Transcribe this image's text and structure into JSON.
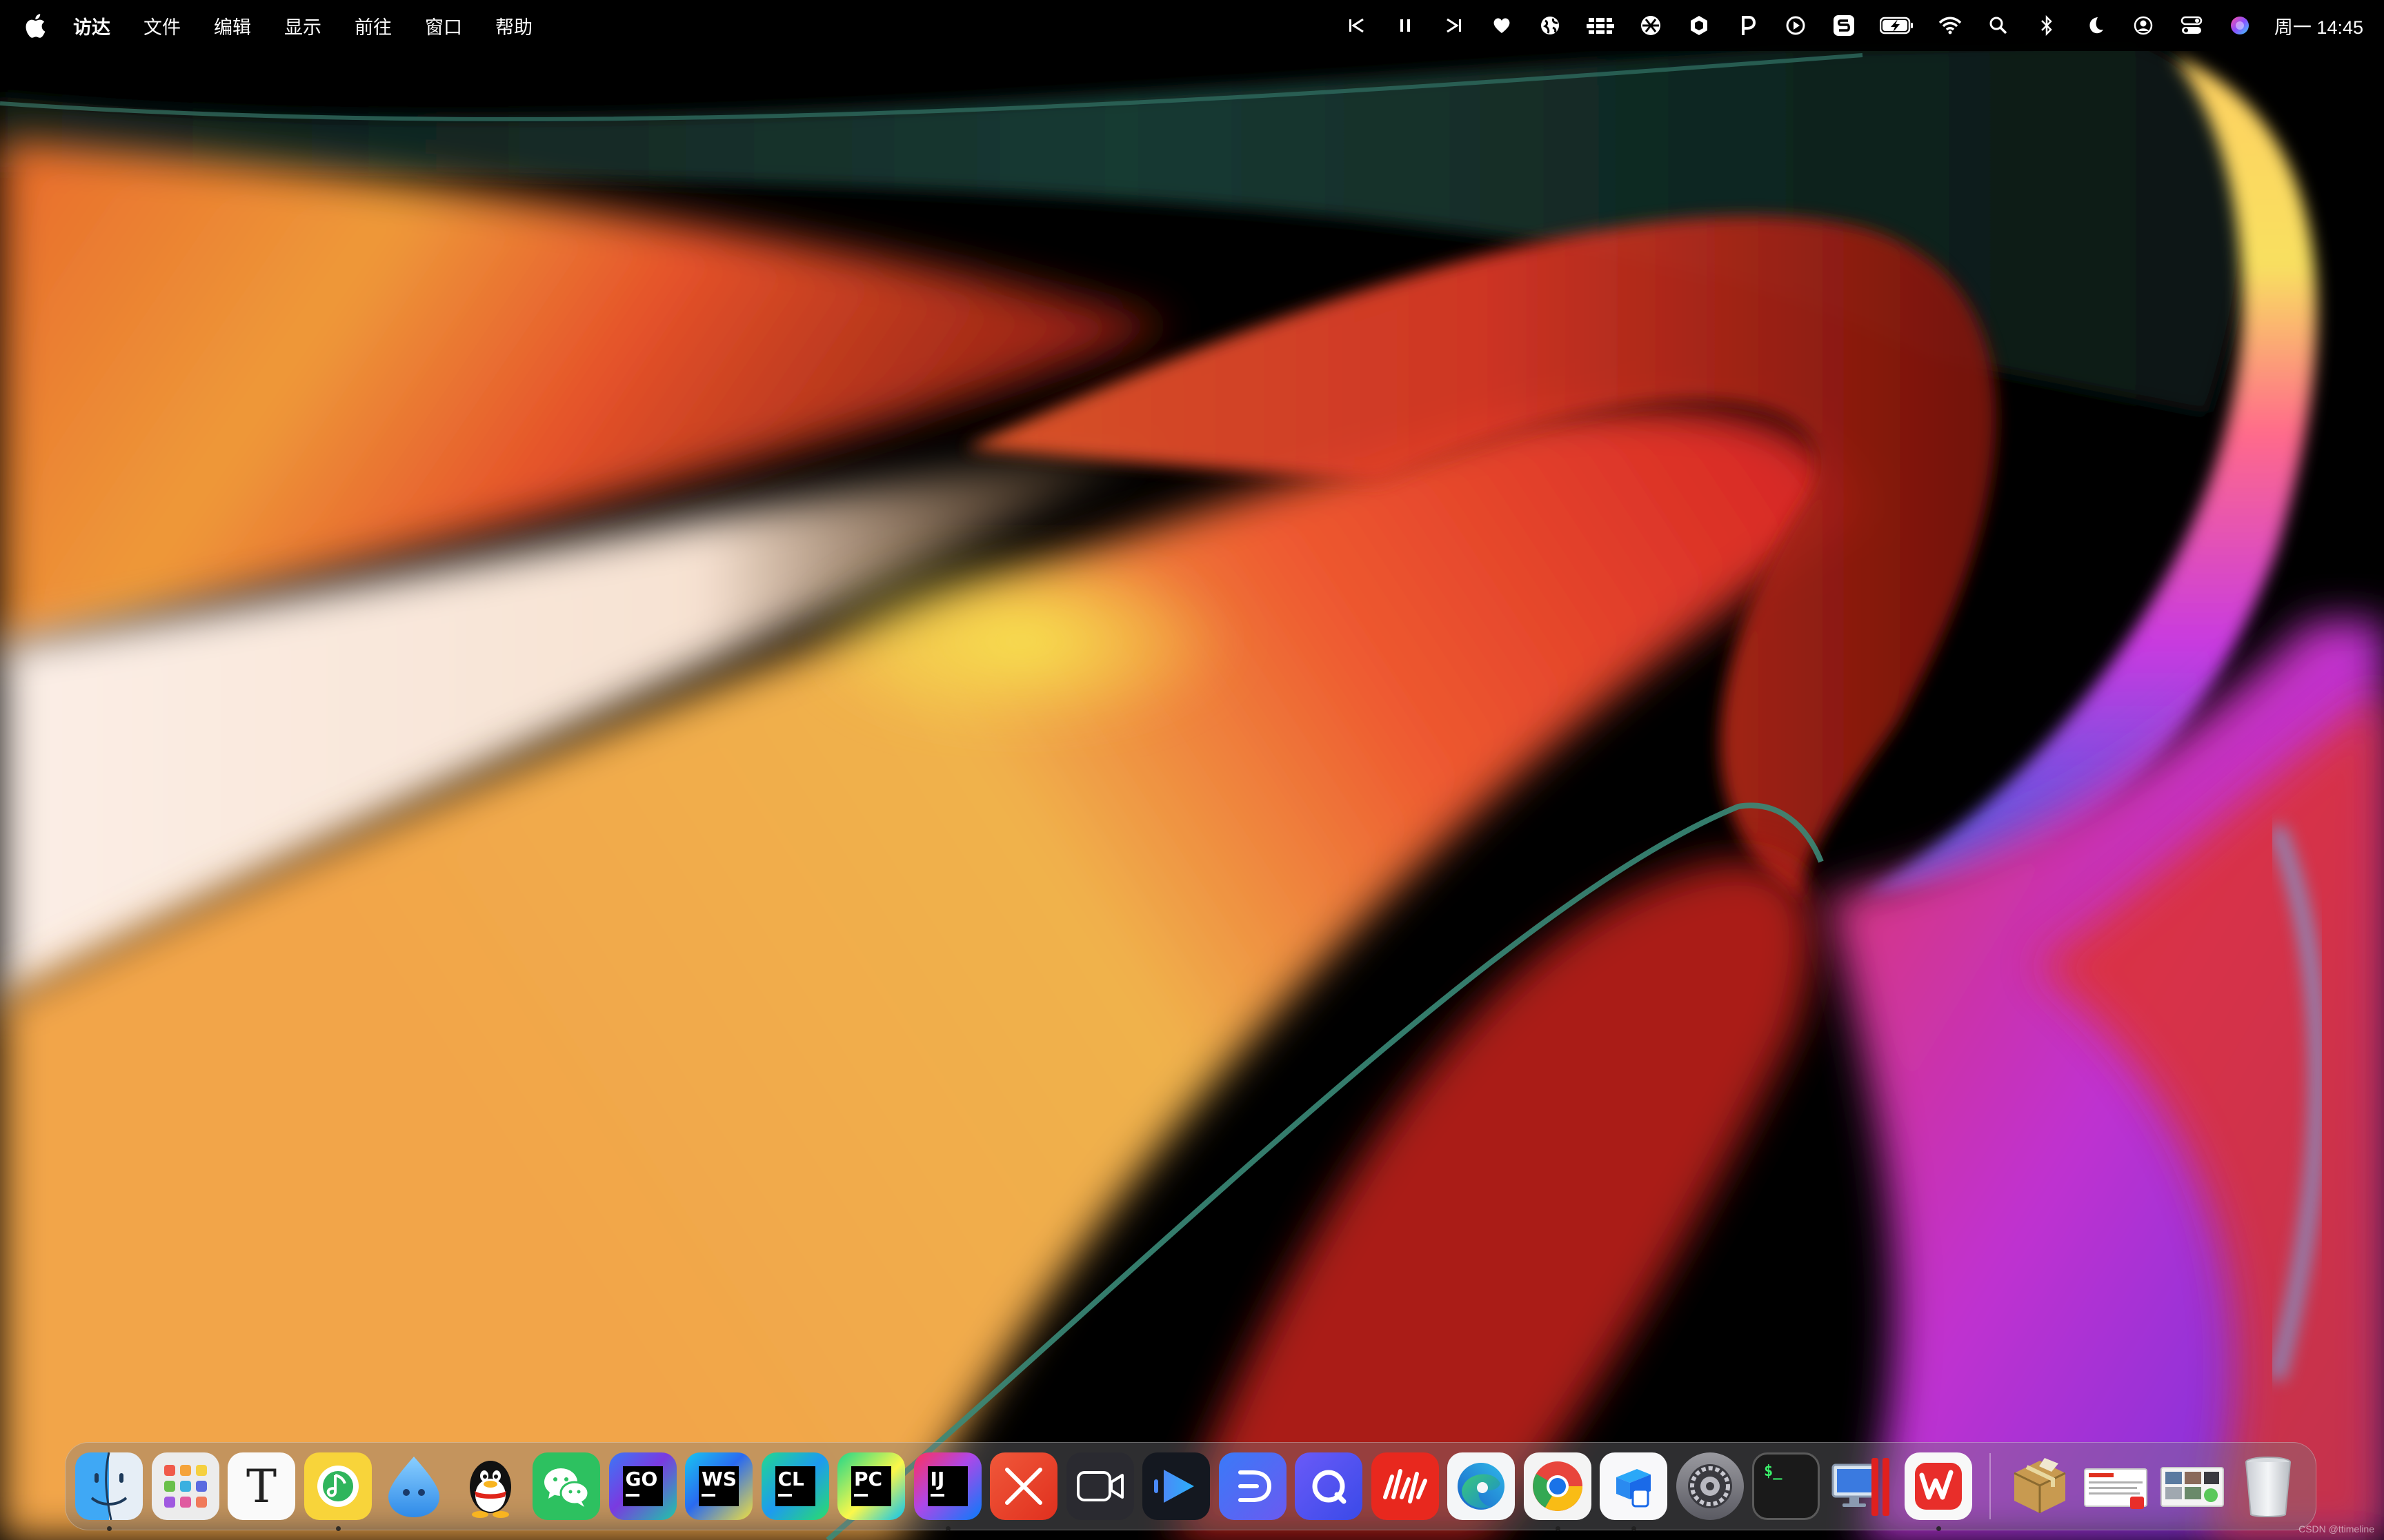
{
  "menubar": {
    "app_name": "访达",
    "menus": [
      "文件",
      "编辑",
      "显示",
      "前往",
      "窗口",
      "帮助"
    ],
    "clock": "周一 14:45",
    "tray_icons": [
      "previous-track-icon",
      "pause-icon",
      "next-track-icon",
      "heart-icon",
      "globe-icon",
      "bartender-icon",
      "aperture-icon",
      "shield-hex-icon",
      "p-app-icon",
      "play-circle-icon",
      "s-app-icon",
      "battery-charging-icon",
      "wifi-icon",
      "spotlight-search-icon",
      "bluetooth-icon",
      "focus-moon-icon",
      "user-account-icon",
      "control-center-icon",
      "siri-icon"
    ]
  },
  "dock": {
    "apps": [
      {
        "name": "finder-icon",
        "running": true
      },
      {
        "name": "launchpad-icon",
        "running": false
      },
      {
        "name": "typora-icon",
        "label": "T",
        "running": false
      },
      {
        "name": "qq-music-icon",
        "running": true
      },
      {
        "name": "water-drop-app-icon",
        "running": false
      },
      {
        "name": "qq-penguin-icon",
        "running": false
      },
      {
        "name": "wechat-icon",
        "running": false
      },
      {
        "name": "goland-icon",
        "label": "GO",
        "running": false
      },
      {
        "name": "webstorm-icon",
        "label": "WS",
        "running": false
      },
      {
        "name": "clion-icon",
        "label": "CL",
        "running": false
      },
      {
        "name": "pycharm-icon",
        "label": "PC",
        "running": false
      },
      {
        "name": "intellij-idea-icon",
        "label": "IJ",
        "running": true
      },
      {
        "name": "xmind-icon",
        "running": false
      },
      {
        "name": "video-camera-icon",
        "running": false
      },
      {
        "name": "infuse-play-icon",
        "running": false
      },
      {
        "name": "lark-d-icon",
        "running": false
      },
      {
        "name": "loop-app-icon",
        "running": false
      },
      {
        "name": "netease-music-wave-icon",
        "running": false
      },
      {
        "name": "edge-browser-icon",
        "running": false
      },
      {
        "name": "chrome-browser-icon",
        "running": true
      },
      {
        "name": "tencent-meeting-icon",
        "running": true
      },
      {
        "name": "system-settings-icon",
        "running": false
      },
      {
        "name": "terminal-icon",
        "label": "$_",
        "running": false
      },
      {
        "name": "parallels-desktop-icon",
        "running": false
      },
      {
        "name": "wps-office-icon",
        "running": true
      }
    ],
    "stacks": [
      {
        "name": "installer-package-icon"
      },
      {
        "name": "document-thumbnail-icon"
      },
      {
        "name": "screenshot-thumbnail-icon"
      },
      {
        "name": "trash-icon"
      }
    ]
  },
  "watermark": "CSDN @ttimeline",
  "colors": {
    "menubar_bg": "#000000",
    "accent_orange": "#E8A040",
    "accent_red": "#E0302A",
    "accent_green": "#1E4A40"
  }
}
